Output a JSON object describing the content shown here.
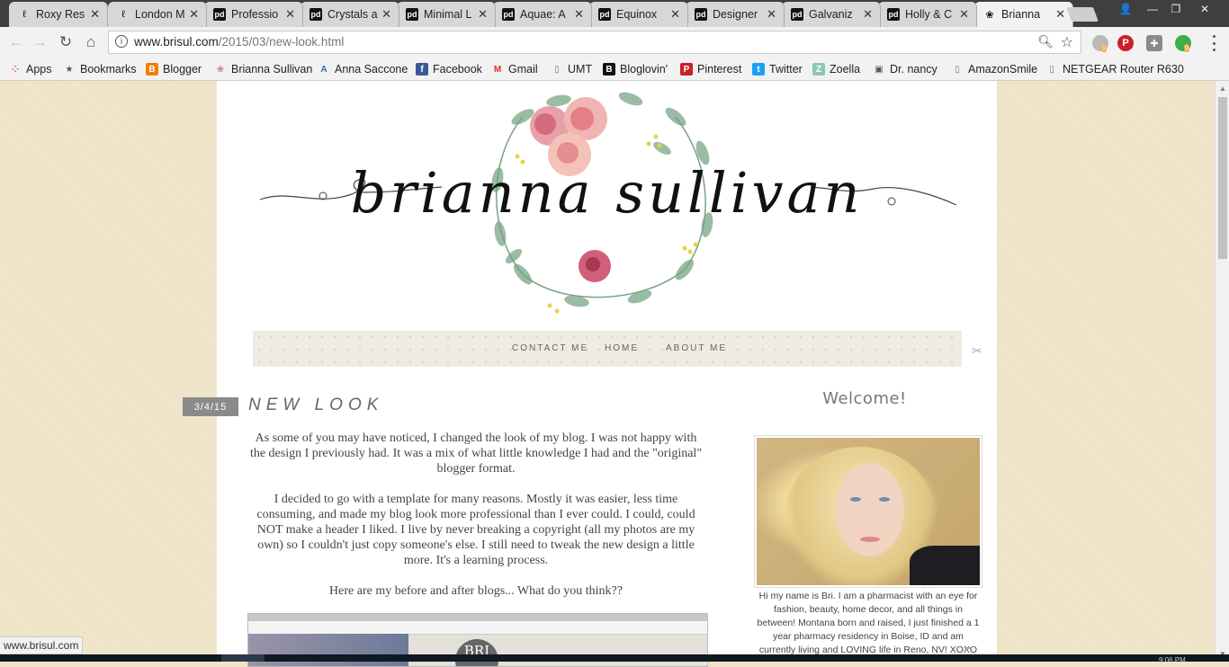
{
  "tabs": [
    {
      "title": "Roxy Res",
      "fav": "ℓ",
      "pd": false
    },
    {
      "title": "London M",
      "fav": "ℓ",
      "pd": false
    },
    {
      "title": "Professio",
      "fav": "pd",
      "pd": true
    },
    {
      "title": "Crystals a",
      "fav": "pd",
      "pd": true
    },
    {
      "title": "Minimal L",
      "fav": "pd",
      "pd": true
    },
    {
      "title": "Aquae: A",
      "fav": "pd",
      "pd": true
    },
    {
      "title": "Equinox",
      "fav": "pd",
      "pd": true
    },
    {
      "title": "Designer",
      "fav": "pd",
      "pd": true
    },
    {
      "title": "Galvaniz",
      "fav": "pd",
      "pd": true
    },
    {
      "title": "Holly & C",
      "fav": "pd",
      "pd": true
    },
    {
      "title": "Brianna",
      "fav": "❀",
      "pd": false
    }
  ],
  "toolbar": {
    "url_host": "www.brisul.com",
    "url_path": "/2015/03/new-look.html",
    "ext_badge_1": "9",
    "ext_badge_2": "9"
  },
  "bookmarks": [
    {
      "label": "Apps",
      "icon": "apps-icon"
    },
    {
      "label": "Bookmarks",
      "icon": "star-icon"
    },
    {
      "label": "Blogger",
      "icon": "blogger-icon"
    },
    {
      "label": "Brianna Sullivan",
      "icon": "wreath-icon"
    },
    {
      "label": "Anna Saccone",
      "icon": "as-icon"
    },
    {
      "label": "Facebook",
      "icon": "facebook-icon"
    },
    {
      "label": "Gmail",
      "icon": "gmail-icon"
    },
    {
      "label": "UMT",
      "icon": "page-icon"
    },
    {
      "label": "Bloglovin'",
      "icon": "bloglovin-icon"
    },
    {
      "label": "Pinterest",
      "icon": "pinterest-icon"
    },
    {
      "label": "Twitter",
      "icon": "twitter-icon"
    },
    {
      "label": "Zoella",
      "icon": "zoella-icon"
    },
    {
      "label": "Dr. nancy",
      "icon": "dr-nancy-icon"
    },
    {
      "label": "AmazonSmile",
      "icon": "page-icon"
    },
    {
      "label": "NETGEAR Router R630",
      "icon": "page-icon"
    }
  ],
  "blog": {
    "title": "brianna sullivan",
    "nav": [
      "CONTACT ME",
      "HOME",
      "ABOUT ME"
    ],
    "post": {
      "date": "3/4/15",
      "title": "NEW LOOK",
      "paragraphs": [
        "As some of you may have noticed, I changed the look of my blog. I was not happy with the design I previously had. It was a mix of what little knowledge I had and the \"original\" blogger format.",
        "I decided to go with a template for many reasons. Mostly it was easier, less time consuming, and made my blog look more professional than I ever could. I could, could NOT make a header I liked. I live by never breaking a copyright (all my photos are my own) so I couldn't just copy someone's else. I still need to tweak the new design a little more. It's a learning process.",
        "Here are my before and after blogs... What do you think??"
      ],
      "image_badge": "BRI"
    },
    "sidebar": {
      "welcome": "Welcome!",
      "bio": "Hi my name is Bri. I am a pharmacist with an eye for fashion, beauty, home decor, and all things in between! Montana born and raised, I just finished a 1 year pharmacy residency in Boise, ID and am currently living and LOVING life in Reno, NV! XOXO"
    }
  },
  "statusbar": {
    "text": "www.brisul.com"
  },
  "clock": {
    "time": "9:06 PM"
  },
  "colors": {
    "accent_pink": "#e66f8a",
    "leaf_green": "#8fb59a",
    "page_bg": "#efe4c8"
  }
}
